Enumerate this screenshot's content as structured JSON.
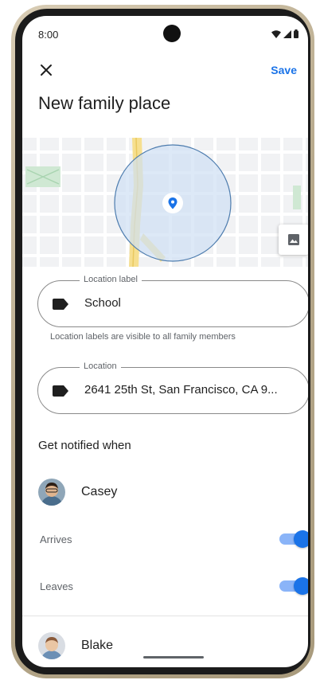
{
  "status_bar": {
    "time": "8:00"
  },
  "app_bar": {
    "close_icon": "close-icon",
    "save_label": "Save",
    "title": "New family place"
  },
  "map": {
    "accent": "#1a73e8",
    "radius_fill": "#cfe0f3",
    "image_icon": "image-icon"
  },
  "location_label_field": {
    "legend": "Location label",
    "value": "School",
    "icon": "label-icon",
    "helper": "Location labels are visible to all family members"
  },
  "location_field": {
    "legend": "Location",
    "value": "2641 25th St, San Francisco, CA 9...",
    "icon": "label-icon"
  },
  "notify": {
    "title": "Get notified when",
    "people": [
      {
        "name": "Casey",
        "toggles": [
          {
            "label": "Arrives",
            "on": true
          },
          {
            "label": "Leaves",
            "on": true
          }
        ]
      },
      {
        "name": "Blake"
      }
    ]
  },
  "colors": {
    "accent": "#1a73e8",
    "toggle_track": "#8ab4f8"
  }
}
